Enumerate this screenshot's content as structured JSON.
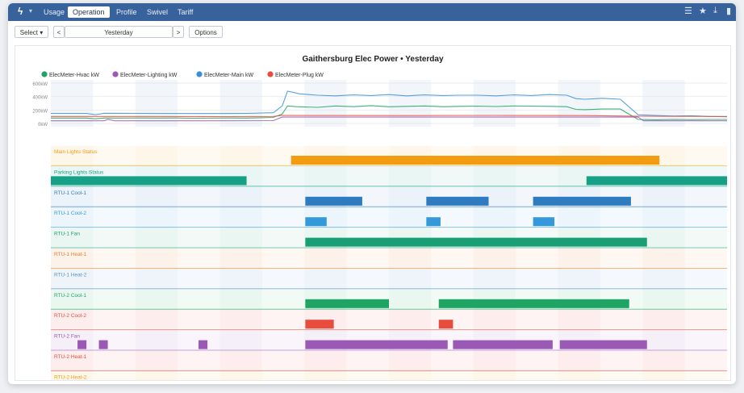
{
  "nav": {
    "logo_glyph": "ϟ",
    "caret_glyph": "▾",
    "tabs": [
      "Usage",
      "Operation",
      "Profile",
      "Swivel",
      "Tariff"
    ],
    "active_tab": "Operation",
    "right_icons": [
      "menu-icon",
      "star-icon",
      "download-icon",
      "panel-icon"
    ]
  },
  "toolbar": {
    "select_label": "Select ▾",
    "prev_glyph": "<",
    "date_value": "Yesterday",
    "next_glyph": ">",
    "options_label": "Options"
  },
  "chart_data": [
    {
      "type": "line",
      "title": "Gaithersburg Elec Power • Yesterday",
      "legend_placement": "top-left",
      "grid": true,
      "y_ticks": [
        "600kW",
        "400kW",
        "200kW",
        "0kW"
      ],
      "ylim": [
        0,
        600
      ],
      "xlim": [
        0,
        24
      ],
      "series": [
        {
          "name": "ElecMeter-Hvac kW",
          "color": "#1fa463",
          "points": [
            [
              0,
              80
            ],
            [
              2,
              80
            ],
            [
              2.5,
              70
            ],
            [
              3,
              82
            ],
            [
              4,
              80
            ],
            [
              5,
              82
            ],
            [
              6,
              80
            ],
            [
              7,
              82
            ],
            [
              8,
              78
            ],
            [
              9,
              80
            ],
            [
              10,
              82
            ],
            [
              11,
              80
            ],
            [
              12.5,
              90
            ],
            [
              13,
              140
            ],
            [
              13.3,
              260
            ],
            [
              13.8,
              250
            ],
            [
              15,
              240
            ],
            [
              16,
              260
            ],
            [
              17,
              250
            ],
            [
              18,
              265
            ],
            [
              19,
              248
            ],
            [
              20,
              255
            ],
            [
              21,
              260
            ],
            [
              22,
              250
            ],
            [
              23,
              255
            ],
            [
              24,
              258
            ],
            [
              25,
              252
            ],
            [
              26,
              260
            ],
            [
              27,
              258
            ],
            [
              28,
              255
            ],
            [
              29,
              250
            ],
            [
              29.5,
              210
            ],
            [
              30,
              205
            ],
            [
              31,
              215
            ],
            [
              32,
              215
            ],
            [
              33,
              60
            ],
            [
              34,
              55
            ],
            [
              35,
              60
            ],
            [
              36,
              58
            ],
            [
              37,
              60
            ],
            [
              38,
              60
            ]
          ]
        },
        {
          "name": "ElecMeter-Lighting kW",
          "color": "#9b59b6",
          "points": [
            [
              0,
              40
            ],
            [
              3,
              40
            ],
            [
              3.2,
              60
            ],
            [
              3.6,
              40
            ],
            [
              8,
              40
            ],
            [
              12.5,
              42
            ],
            [
              13,
              95
            ],
            [
              33,
              95
            ],
            [
              33.3,
              40
            ],
            [
              38,
              40
            ]
          ]
        },
        {
          "name": "ElecMeter-Main kW",
          "color": "#3b8fd9",
          "points": [
            [
              0,
              150
            ],
            [
              2,
              150
            ],
            [
              2.5,
              130
            ],
            [
              3,
              152
            ],
            [
              5,
              150
            ],
            [
              8,
              148
            ],
            [
              11,
              150
            ],
            [
              12.5,
              160
            ],
            [
              13,
              260
            ],
            [
              13.3,
              480
            ],
            [
              14,
              440
            ],
            [
              15,
              420
            ],
            [
              16,
              410
            ],
            [
              17,
              425
            ],
            [
              18,
              415
            ],
            [
              19,
              430
            ],
            [
              20,
              410
            ],
            [
              21,
              425
            ],
            [
              22,
              415
            ],
            [
              23,
              420
            ],
            [
              24,
              420
            ],
            [
              25,
              410
            ],
            [
              26,
              425
            ],
            [
              27,
              415
            ],
            [
              28,
              430
            ],
            [
              29,
              420
            ],
            [
              29.5,
              370
            ],
            [
              30,
              360
            ],
            [
              31,
              375
            ],
            [
              32,
              360
            ],
            [
              33,
              130
            ],
            [
              34,
              120
            ],
            [
              35,
              110
            ],
            [
              36,
              115
            ],
            [
              37,
              105
            ],
            [
              38,
              100
            ]
          ]
        },
        {
          "name": "ElecMeter-Plug kW",
          "color": "#e74c3c",
          "points": [
            [
              0,
              105
            ],
            [
              5,
              105
            ],
            [
              10,
              102
            ],
            [
              12.5,
              105
            ],
            [
              13,
              120
            ],
            [
              20,
              118
            ],
            [
              25,
              120
            ],
            [
              30,
              118
            ],
            [
              33,
              108
            ],
            [
              38,
              105
            ]
          ]
        }
      ]
    },
    {
      "type": "bar",
      "subtype": "status-timeline",
      "xlim": [
        0,
        24
      ],
      "rows": [
        {
          "label": "Main Lights Status",
          "color": "#f39c12",
          "segments": [
            [
              13.5,
              34.2
            ]
          ]
        },
        {
          "label": "Parking Lights Status",
          "color": "#16a085",
          "segments": [
            [
              0,
              11
            ],
            [
              30.1,
              38
            ]
          ]
        },
        {
          "label": "RTU-1 Cool-1",
          "color": "#2e7bbf",
          "segments": [
            [
              14.3,
              17.5
            ],
            [
              21.1,
              24.6
            ],
            [
              27.1,
              32.6
            ]
          ]
        },
        {
          "label": "RTU-1 Cool-2",
          "color": "#3498db",
          "segments": [
            [
              14.3,
              15.5
            ],
            [
              21.1,
              21.9
            ],
            [
              27.1,
              28.3
            ]
          ]
        },
        {
          "label": "RTU-1 Fan",
          "color": "#1a9e73",
          "segments": [
            [
              14.3,
              33.5
            ]
          ]
        },
        {
          "label": "RTU-1 Heat-1",
          "color": "#e67e22",
          "segments": []
        },
        {
          "label": "RTU-1 Heat-2",
          "color": "#5b8fc9",
          "segments": []
        },
        {
          "label": "RTU-2 Cool-1",
          "color": "#1fa463",
          "segments": [
            [
              14.3,
              19.0
            ],
            [
              21.8,
              32.5
            ]
          ]
        },
        {
          "label": "RTU-2 Cool-2",
          "color": "#e74c3c",
          "segments": [
            [
              14.3,
              15.9
            ],
            [
              21.8,
              22.6
            ]
          ]
        },
        {
          "label": "RTU-2 Fan",
          "color": "#9b59b6",
          "segments": [
            [
              1.5,
              2.0
            ],
            [
              2.7,
              3.2
            ],
            [
              8.3,
              8.8
            ],
            [
              14.3,
              22.3
            ],
            [
              22.6,
              28.2
            ],
            [
              28.6,
              33.5
            ]
          ]
        },
        {
          "label": "RTU-2 Heat-1",
          "color": "#e74c3c",
          "segments": []
        },
        {
          "label": "RTU-2 Heat-2",
          "color": "#f39c12",
          "segments": []
        }
      ]
    }
  ]
}
